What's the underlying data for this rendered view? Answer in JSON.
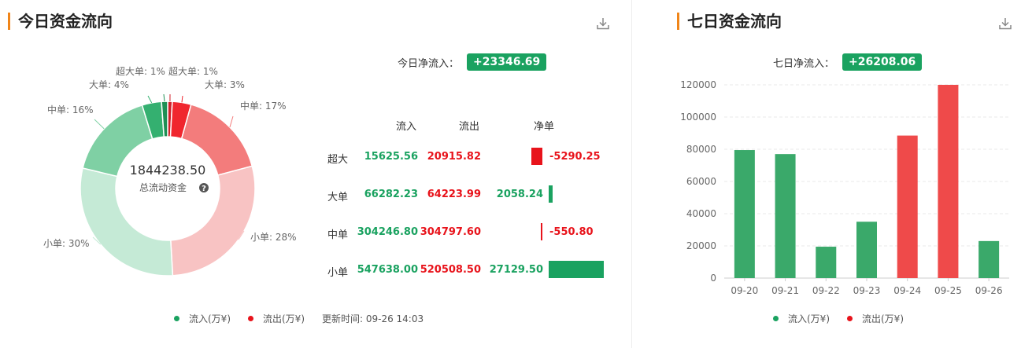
{
  "left": {
    "title": "今日资金流向",
    "net_label": "今日净流入：",
    "net_value": "+23346.69",
    "center_value": "1844238.50",
    "center_label": "总流动资金",
    "table_headers": [
      "流入",
      "流出",
      "净单"
    ],
    "rows": [
      {
        "cat": "超大",
        "inflow": "15625.56",
        "outflow": "20915.82",
        "net": "-5290.25",
        "net_num": -5290.25
      },
      {
        "cat": "大单",
        "inflow": "66282.23",
        "outflow": "64223.99",
        "net": "2058.24",
        "net_num": 2058.24
      },
      {
        "cat": "中单",
        "inflow": "304246.80",
        "outflow": "304797.60",
        "net": "-550.80",
        "net_num": -550.8
      },
      {
        "cat": "小单",
        "inflow": "547638.00",
        "outflow": "520508.50",
        "net": "27129.50",
        "net_num": 27129.5
      }
    ],
    "legend_in": "流入(万¥)",
    "legend_out": "流出(万¥)",
    "update_text": "更新时间: 09-26 14:03"
  },
  "right": {
    "title": "七日资金流向",
    "net_label": "七日净流入：",
    "net_value": "+26208.06",
    "legend_in": "流入(万¥)",
    "legend_out": "流出(万¥)"
  },
  "colors": {
    "green": "#1aa260",
    "red": "#e8131b",
    "accent": "#f08519"
  },
  "chart_data": [
    {
      "type": "pie",
      "variant": "donut",
      "total": 1844238.5,
      "slices": [
        {
          "label": "超大单: 1%",
          "value": 15625.56,
          "color": "#d11f2a"
        },
        {
          "label": "大单: 3%",
          "value": 64223.99,
          "color": "#f0262e"
        },
        {
          "label": "中单: 17%",
          "value": 304797.6,
          "color": "#f37c7c"
        },
        {
          "label": "小单: 28%",
          "value": 520508.5,
          "color": "#f8c3c3"
        },
        {
          "label": "小单: 30%",
          "value": 547638.0,
          "color": "#c5ead6"
        },
        {
          "label": "中单: 16%",
          "value": 304246.8,
          "color": "#7fd0a4"
        },
        {
          "label": "大单: 4%",
          "value": 66282.23,
          "color": "#34b070"
        },
        {
          "label": "超大单: 1%",
          "value": 20915.82,
          "color": "#1f8f55"
        }
      ]
    },
    {
      "type": "bar",
      "categories": [
        "09-20",
        "09-21",
        "09-22",
        "09-23",
        "09-24",
        "09-25",
        "09-26"
      ],
      "values": [
        79500,
        77000,
        19500,
        35000,
        88500,
        120000,
        23000
      ],
      "direction": [
        "in",
        "in",
        "in",
        "in",
        "out",
        "out",
        "in"
      ],
      "ylim": [
        0,
        120000
      ],
      "yticks": [
        0,
        20000,
        40000,
        60000,
        80000,
        100000,
        120000
      ],
      "grid": true
    }
  ]
}
